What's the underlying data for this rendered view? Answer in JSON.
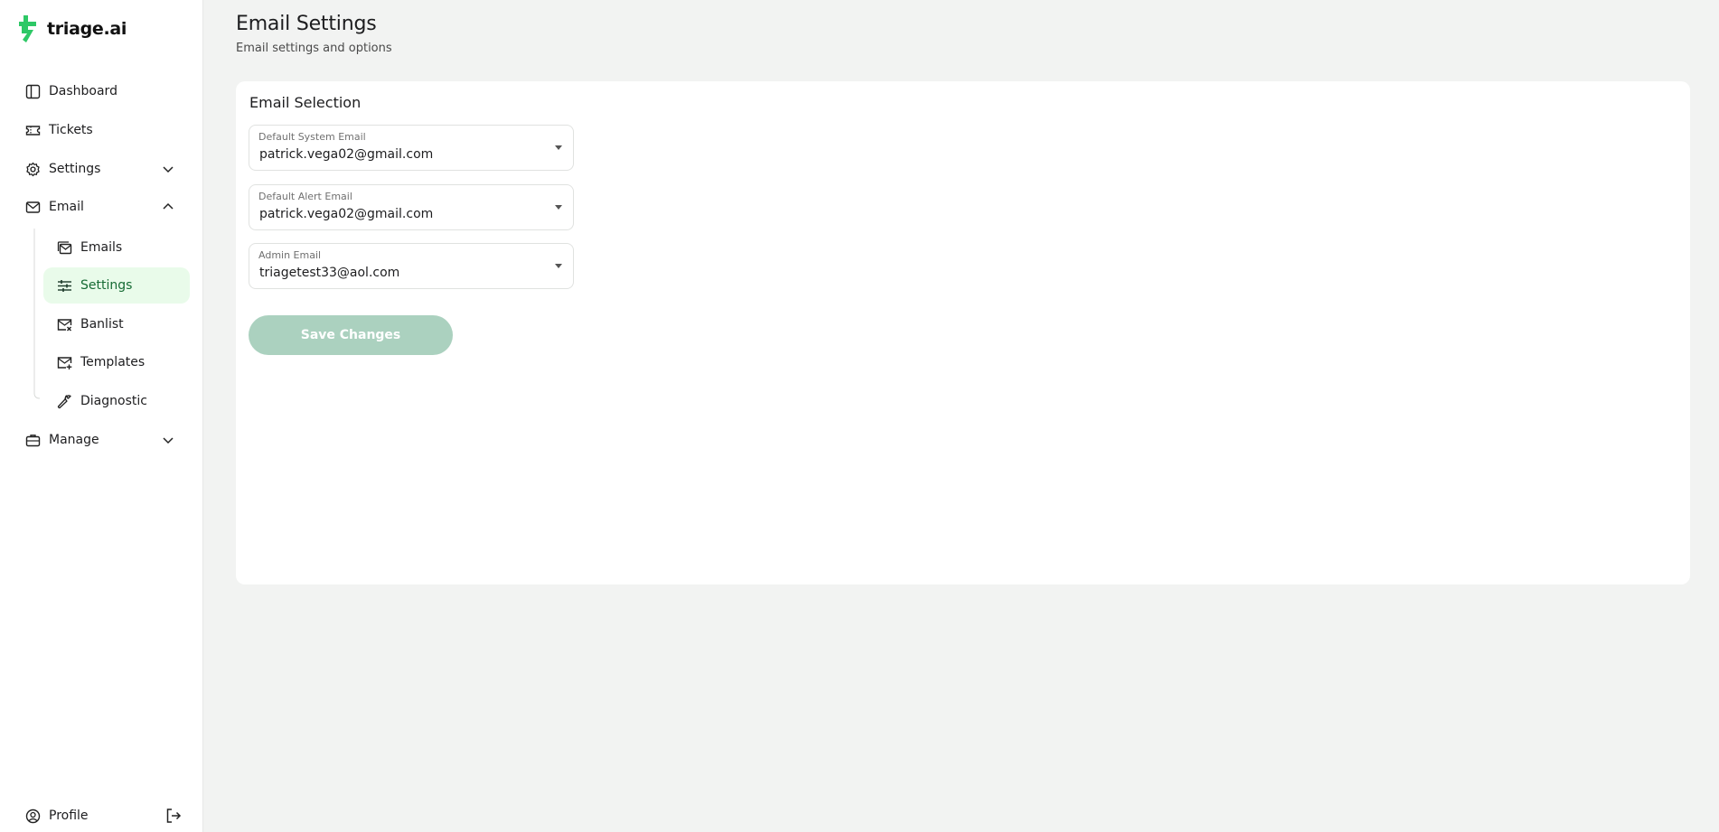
{
  "brand": {
    "name": "triage.ai",
    "accent": "#2ec866"
  },
  "sidebar": {
    "items": [
      {
        "label": "Dashboard",
        "icon": "dashboard-icon"
      },
      {
        "label": "Tickets",
        "icon": "ticket-icon"
      },
      {
        "label": "Settings",
        "icon": "gear-icon",
        "expanded": false
      },
      {
        "label": "Email",
        "icon": "mail-icon",
        "expanded": true
      },
      {
        "label": "Manage",
        "icon": "briefcase-icon",
        "expanded": false
      }
    ],
    "email_sub": [
      {
        "label": "Emails",
        "icon": "mail-stack-icon"
      },
      {
        "label": "Settings",
        "icon": "sliders-icon",
        "active": true
      },
      {
        "label": "Banlist",
        "icon": "mail-x-icon"
      },
      {
        "label": "Templates",
        "icon": "mail-plus-icon"
      },
      {
        "label": "Diagnostic",
        "icon": "wrench-icon"
      }
    ],
    "profile_label": "Profile"
  },
  "page": {
    "title": "Email Settings",
    "subtitle": "Email settings and options"
  },
  "card": {
    "title": "Email Selection",
    "fields": [
      {
        "label": "Default System Email",
        "value": "patrick.vega02@gmail.com"
      },
      {
        "label": "Default Alert Email",
        "value": "patrick.vega02@gmail.com"
      },
      {
        "label": "Admin Email",
        "value": "triagetest33@aol.com"
      }
    ],
    "save_label": "Save Changes",
    "save_disabled": true
  }
}
